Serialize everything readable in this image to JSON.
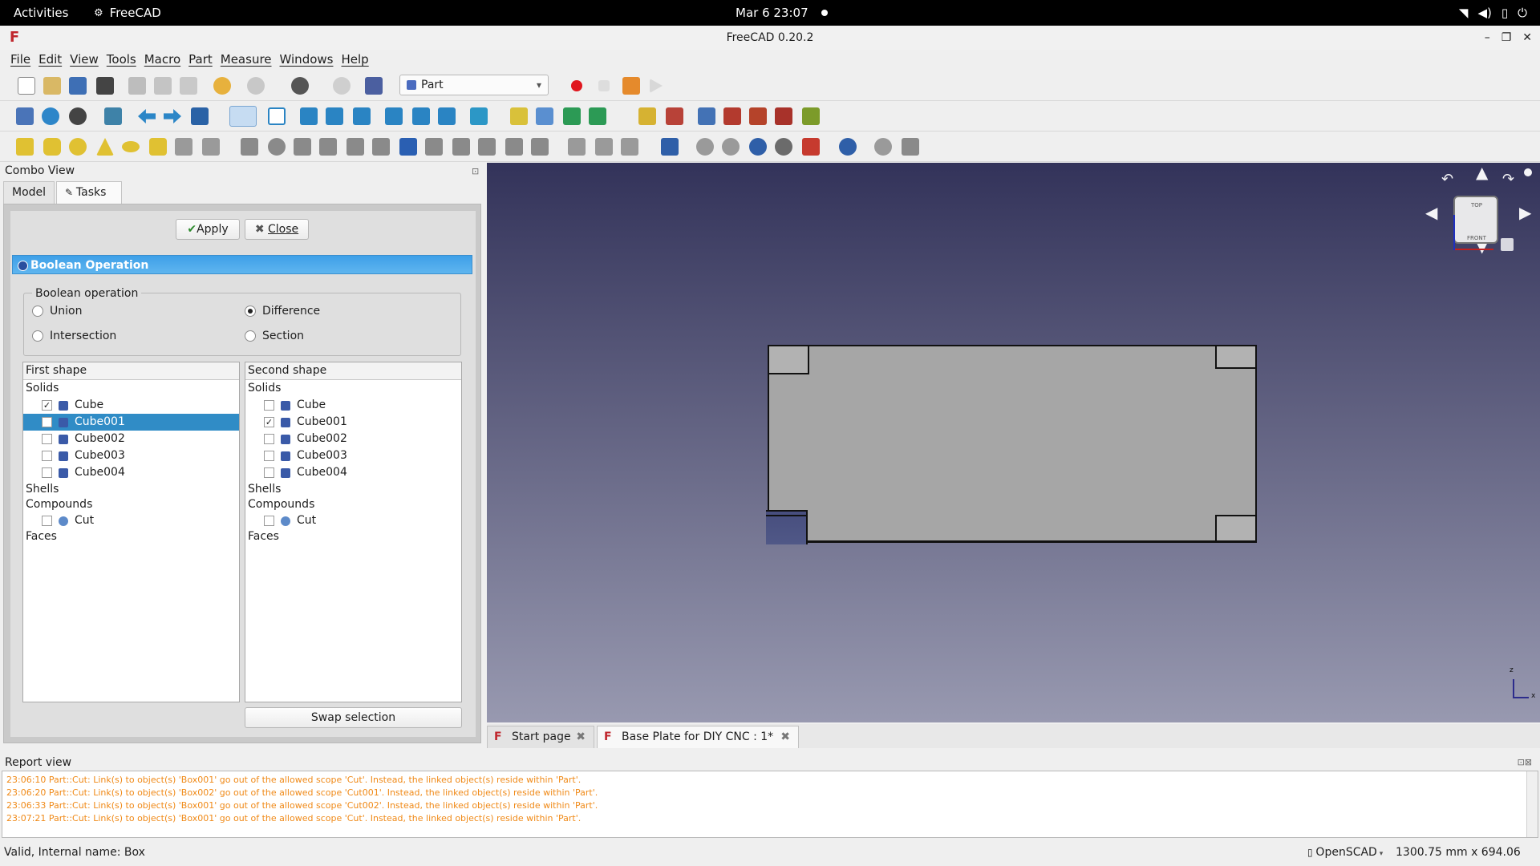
{
  "system_bar": {
    "activities": "Activities",
    "app": "FreeCAD",
    "clock": "Mar 6  23:07",
    "icons": [
      "wifi-icon",
      "volume-icon",
      "battery-icon",
      "power-icon"
    ]
  },
  "window": {
    "title": "FreeCAD 0.20.2",
    "controls": [
      "–",
      "❐",
      "✕"
    ]
  },
  "menu": [
    "File",
    "Edit",
    "View",
    "Tools",
    "Macro",
    "Part",
    "Measure",
    "Windows",
    "Help"
  ],
  "toolbar": {
    "workbench": "Part"
  },
  "combo_view": {
    "title": "Combo View",
    "tabs": [
      "Model",
      "Tasks"
    ],
    "active_tab": "Tasks",
    "apply_label": "Apply",
    "close_label": "Close",
    "panel_title": "Boolean Operation",
    "group_title": "Boolean operation",
    "options": [
      {
        "label": "Union",
        "checked": false
      },
      {
        "label": "Difference",
        "checked": true
      },
      {
        "label": "Intersection",
        "checked": false
      },
      {
        "label": "Section",
        "checked": false
      }
    ],
    "first_shape": {
      "header": "First shape",
      "solids_label": "Solids",
      "solids": [
        {
          "label": "Cube",
          "checked": true
        },
        {
          "label": "Cube001",
          "checked": false,
          "selected": true
        },
        {
          "label": "Cube002",
          "checked": false
        },
        {
          "label": "Cube003",
          "checked": false
        },
        {
          "label": "Cube004",
          "checked": false
        }
      ],
      "shells_label": "Shells",
      "compounds_label": "Compounds",
      "compounds": [
        {
          "label": "Cut",
          "checked": false
        }
      ],
      "faces_label": "Faces"
    },
    "second_shape": {
      "header": "Second shape",
      "solids_label": "Solids",
      "solids": [
        {
          "label": "Cube",
          "checked": false
        },
        {
          "label": "Cube001",
          "checked": true
        },
        {
          "label": "Cube002",
          "checked": false
        },
        {
          "label": "Cube003",
          "checked": false
        },
        {
          "label": "Cube004",
          "checked": false
        }
      ],
      "shells_label": "Shells",
      "compounds_label": "Compounds",
      "compounds": [
        {
          "label": "Cut",
          "checked": false
        }
      ],
      "faces_label": "Faces"
    },
    "swap_label": "Swap selection"
  },
  "viewport": {
    "navcube_top": "TOP",
    "navcube_front": "FRONT",
    "axis_z": "z",
    "axis_x": "x"
  },
  "doc_tabs": [
    {
      "label": "Start page",
      "active": false
    },
    {
      "label": "Base Plate for DIY CNC : 1*",
      "active": true
    }
  ],
  "report": {
    "title": "Report view",
    "lines": [
      "23:06:10  Part::Cut: Link(s) to object(s) 'Box001' go out of the allowed scope 'Cut'. Instead, the linked object(s) reside within 'Part'.",
      "23:06:20  Part::Cut: Link(s) to object(s) 'Box002' go out of the allowed scope 'Cut001'. Instead, the linked object(s) reside within 'Part'.",
      "23:06:33  Part::Cut: Link(s) to object(s) 'Box001' go out of the allowed scope 'Cut002'. Instead, the linked object(s) reside within 'Part'.",
      "23:07:21  Part::Cut: Link(s) to object(s) 'Box001' go out of the allowed scope 'Cut'. Instead, the linked object(s) reside within 'Part'."
    ]
  },
  "status": {
    "message": "Valid, Internal name: Box",
    "navigation": "OpenSCAD",
    "dimensions": "1300.75 mm x 694.06 mm"
  }
}
